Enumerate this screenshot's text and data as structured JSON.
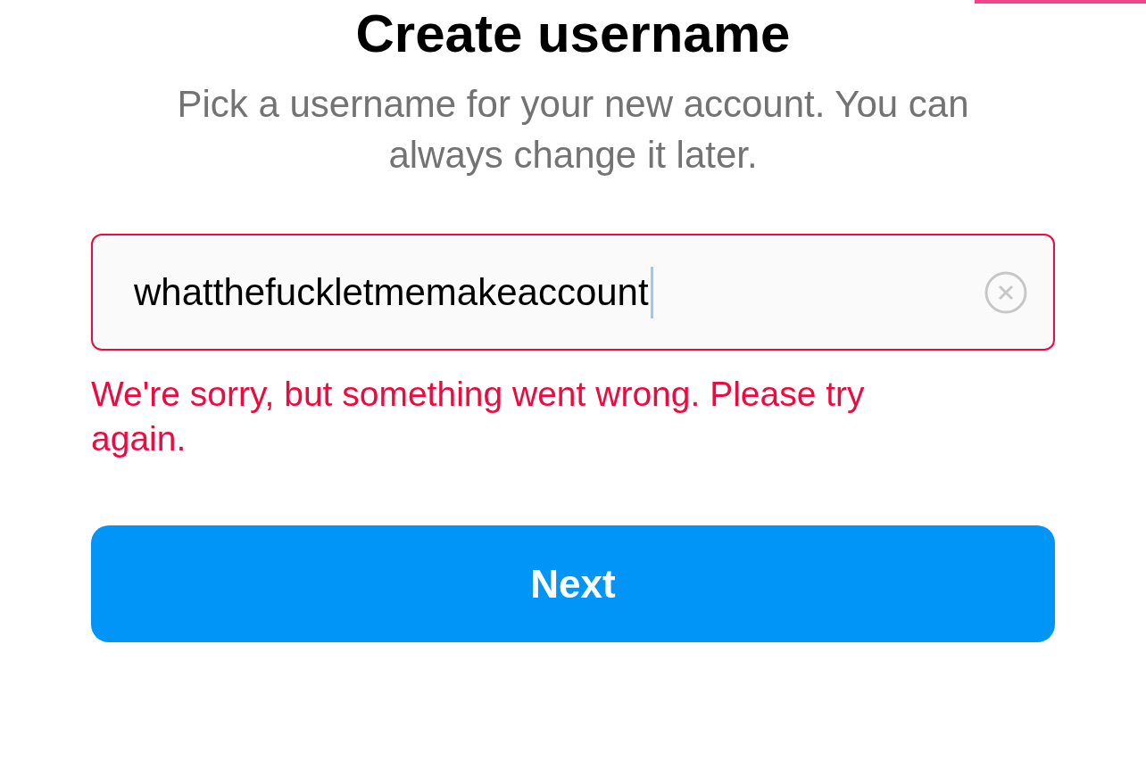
{
  "title": "Create username",
  "subtitle": "Pick a username for your new account. You can always change it later.",
  "username_field": {
    "value": "whatthefuckletmemakeaccount",
    "invalid": true,
    "focused": true
  },
  "error_message": "We're sorry, but something went wrong. Please try again.",
  "next_button": {
    "label": "Next",
    "disabled": false
  }
}
